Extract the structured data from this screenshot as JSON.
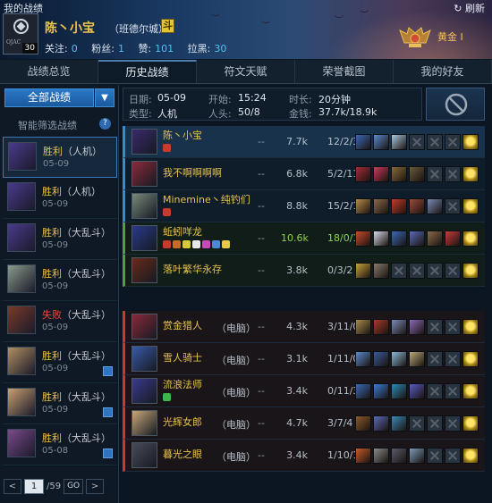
{
  "window": {
    "title": "我的战绩",
    "refresh_label": "刷新"
  },
  "profile": {
    "level": "30",
    "avatar_text": "OJAC",
    "name": "陈丶小宝",
    "server": "（班德尔城）",
    "fight_badge": "斗",
    "follow_label": "关注:",
    "follow": "0",
    "fans_label": "粉丝:",
    "fans": "1",
    "like_label": "赞:",
    "likes": "101",
    "dislike_label": "拉黑:",
    "dislikes": "30",
    "rank": "黄金 I"
  },
  "tabs": [
    "战绩总览",
    "历史战绩",
    "符文天赋",
    "荣誉截图",
    "我的好友"
  ],
  "active_tab": 1,
  "sidebar": {
    "filter_label": "全部战绩",
    "smart_filter_label": "智能筛选战绩",
    "help_label": "?",
    "games": [
      {
        "result": "胜利",
        "mode": "（人机）",
        "date": "05-09",
        "win": true,
        "selected": true,
        "badge": false,
        "color": "#4a3a8c"
      },
      {
        "result": "胜利",
        "mode": "（人机）",
        "date": "05-09",
        "win": true,
        "selected": false,
        "badge": false,
        "color": "#4a3a8c"
      },
      {
        "result": "胜利",
        "mode": "（大乱斗）",
        "date": "05-09",
        "win": true,
        "selected": false,
        "badge": false,
        "color": "#4a3a8c"
      },
      {
        "result": "胜利",
        "mode": "（大乱斗）",
        "date": "05-09",
        "win": true,
        "selected": false,
        "badge": false,
        "color": "#8a9a8a"
      },
      {
        "result": "失败",
        "mode": "（大乱斗）",
        "date": "05-09",
        "win": false,
        "selected": false,
        "badge": false,
        "color": "#7a3a28"
      },
      {
        "result": "胜利",
        "mode": "（大乱斗）",
        "date": "05-09",
        "win": true,
        "selected": false,
        "badge": true,
        "color": "#b09060"
      },
      {
        "result": "胜利",
        "mode": "（大乱斗）",
        "date": "05-09",
        "win": true,
        "selected": false,
        "badge": true,
        "color": "#c8a070"
      },
      {
        "result": "胜利",
        "mode": "（大乱斗）",
        "date": "05-08",
        "win": true,
        "selected": false,
        "badge": true,
        "color": "#7a4a8a"
      }
    ],
    "pager": {
      "prev": "<",
      "page": "1",
      "total": "/59",
      "go": "GO",
      "next": ">"
    }
  },
  "game_info": {
    "date_label": "日期:",
    "date": "05-09",
    "type_label": "类型:",
    "type": "人机",
    "start_label": "开始:",
    "start": "15:24",
    "players_label": "人头:",
    "players": "50/8",
    "duration_label": "时长:",
    "duration": "20分钟",
    "gold_label": "金钱:",
    "gold": "37.7k/18.9k"
  },
  "ally_team": [
    {
      "name": "陈丶小宝",
      "tag": "",
      "gold": "7.7k",
      "kda": "12/2/3",
      "self": true,
      "mvp": false,
      "team": "blue",
      "avatar": "#3a2a6c",
      "icons": [
        "#c83a2a"
      ],
      "items": [
        "#3a6ab8",
        "#5a8ad0",
        "#a8c8e0",
        "empty",
        "empty",
        "empty",
        "trink"
      ]
    },
    {
      "name": "我不啊啊啊啊",
      "tag": "",
      "gold": "6.8k",
      "kda": "5/2/11",
      "self": false,
      "mvp": false,
      "team": "blue",
      "avatar": "#8a2a3a",
      "icons": [],
      "items": [
        "#a82a3a",
        "#c83a5a",
        "#8a6a3a",
        "#6a5a3a",
        "empty",
        "empty",
        "trink"
      ]
    },
    {
      "name": "Minemine丶纯钓们",
      "tag": "",
      "gold": "8.8k",
      "kda": "15/2/11",
      "self": false,
      "mvp": false,
      "team": "blue",
      "avatar": "#7a8a7a",
      "icons": [
        "#c83a2a"
      ],
      "items": [
        "#b88a4a",
        "#8a6a4a",
        "#c83a2a",
        "#a04a3a",
        "#7a8ab8",
        "empty",
        "trink"
      ]
    },
    {
      "name": "蚯蚓咩龙",
      "tag": "",
      "gold": "10.6k",
      "kda": "18/0/17",
      "self": false,
      "mvp": true,
      "team": "green",
      "avatar": "#2a3a8c",
      "icons": [
        "#c83a2a",
        "#c86a2a",
        "#d8c83a",
        "#e8e8e8",
        "#c84ab8",
        "#4a8ad8",
        "#e8c84a"
      ],
      "items": [
        "#c84a2a",
        "#d8d8e8",
        "#3a6ab8",
        "#5a6ab8",
        "#8a6a4a",
        "#c83a3a",
        "trink"
      ]
    },
    {
      "name": "落叶繁华永存",
      "tag": "",
      "gold": "3.8k",
      "kda": "0/3/2",
      "self": false,
      "mvp": false,
      "team": "green",
      "avatar": "#6a2a1a",
      "icons": [],
      "items": [
        "#c8a03a",
        "#8a7a6a",
        "empty",
        "empty",
        "empty",
        "empty",
        "trink"
      ]
    }
  ],
  "enemy_team": [
    {
      "name": "赏金猎人",
      "tag": "（电脑）",
      "gold": "4.3k",
      "kda": "3/11/0",
      "avatar": "#8a2a3a",
      "items": [
        "#a88a4a",
        "#a83a2a",
        "#7a8ab8",
        "#8a6ab8",
        "empty",
        "empty",
        "trink"
      ]
    },
    {
      "name": "雪人骑士",
      "tag": "（电脑）",
      "gold": "3.1k",
      "kda": "1/11/0",
      "avatar": "#3a5aa8",
      "items": [
        "#5a8ad0",
        "#3a5a9a",
        "#8ab8d8",
        "#b8a87a",
        "empty",
        "empty",
        "trink"
      ]
    },
    {
      "name": "流浪法师",
      "tag": "（电脑）",
      "gold": "3.4k",
      "kda": "0/11/3",
      "avatar": "#3a3a8c",
      "items": [
        "#3a6ab8",
        "#3a7ad8",
        "#2a8ab8",
        "#5a5ac8",
        "empty",
        "empty",
        "trink"
      ],
      "icons": [
        "#3ab84a"
      ]
    },
    {
      "name": "光辉女郎",
      "tag": "（电脑）",
      "gold": "4.7k",
      "kda": "3/7/4",
      "avatar": "#c8a87a",
      "items": [
        "#8a5a2a",
        "#5a6ab8",
        "#3a8ab8",
        "empty",
        "empty",
        "empty",
        "trink"
      ]
    },
    {
      "name": "暮光之眼",
      "tag": "（电脑）",
      "gold": "3.4k",
      "kda": "1/10/1",
      "avatar": "#4a4a5a",
      "items": [
        "#c85a2a",
        "#8a8a8a",
        "#5a5a6a",
        "#7a9ab8",
        "empty",
        "empty",
        "trink"
      ]
    }
  ],
  "colors": {
    "gold_text": "#e8c34c",
    "win": "#e8c34c",
    "loss": "#e84c3c",
    "mvp": "#8ed04a",
    "accent_blue": "#2a78c8"
  },
  "icons": {
    "refresh": "refresh-icon",
    "ban": "ban-icon",
    "help": "help-icon",
    "dropdown": "chevron-down-icon",
    "rank": "rank-emblem-icon"
  }
}
